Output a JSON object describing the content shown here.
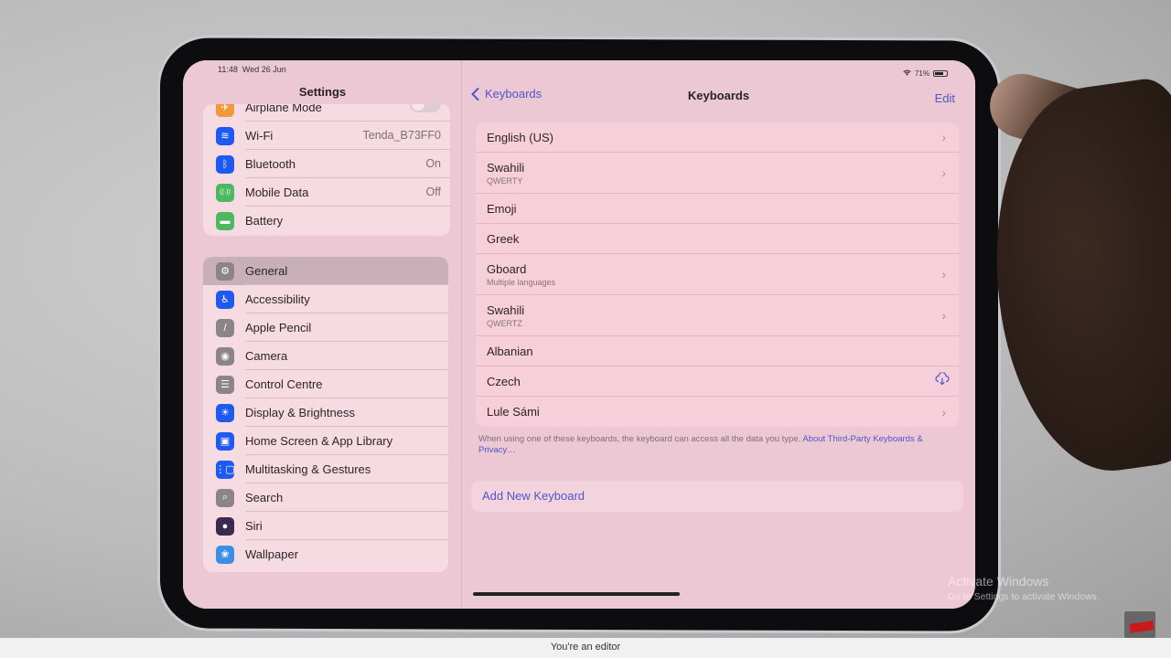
{
  "status": {
    "time": "11:48",
    "date": "Wed 26 Jun",
    "battery": "71%"
  },
  "settings": {
    "title": "Settings",
    "group1": [
      {
        "label": "Airplane Mode",
        "icon": "airplane-icon",
        "color": "#f09a37",
        "toggle": true
      },
      {
        "label": "Wi-Fi",
        "icon": "wifi-icon",
        "color": "#1f5af0",
        "value": "Tenda_B73FF0"
      },
      {
        "label": "Bluetooth",
        "icon": "bluetooth-icon",
        "color": "#1f5af0",
        "value": "On"
      },
      {
        "label": "Mobile Data",
        "icon": "antenna-icon",
        "color": "#4cb860",
        "value": "Off"
      },
      {
        "label": "Battery",
        "icon": "battery-icon",
        "color": "#4cb860"
      }
    ],
    "group2": [
      {
        "label": "General",
        "icon": "gear-icon",
        "color": "#8b8488",
        "selected": true
      },
      {
        "label": "Accessibility",
        "icon": "accessibility-icon",
        "color": "#1f5af0"
      },
      {
        "label": "Apple Pencil",
        "icon": "pencil-icon",
        "color": "#8b8488"
      },
      {
        "label": "Camera",
        "icon": "camera-icon",
        "color": "#8b8488"
      },
      {
        "label": "Control Centre",
        "icon": "switches-icon",
        "color": "#8b8488"
      },
      {
        "label": "Display & Brightness",
        "icon": "sun-icon",
        "color": "#1f5af0"
      },
      {
        "label": "Home Screen & App Library",
        "icon": "home-screen-icon",
        "color": "#1f5af0"
      },
      {
        "label": "Multitasking & Gestures",
        "icon": "multitasking-icon",
        "color": "#1f5af0"
      },
      {
        "label": "Search",
        "icon": "search-icon",
        "color": "#8b8488"
      },
      {
        "label": "Siri",
        "icon": "siri-icon",
        "color": "#3a2b4e"
      },
      {
        "label": "Wallpaper",
        "icon": "flower-icon",
        "color": "#3a8ee6"
      }
    ]
  },
  "keyboards": {
    "back_label": "Keyboards",
    "title": "Keyboards",
    "edit_label": "Edit",
    "items": [
      {
        "name": "English (US)",
        "accessory": "chevron"
      },
      {
        "name": "Swahili",
        "sub": "QWERTY",
        "accessory": "chevron"
      },
      {
        "name": "Emoji"
      },
      {
        "name": "Greek"
      },
      {
        "name": "Gboard",
        "sub": "Multiple languages",
        "accessory": "chevron"
      },
      {
        "name": "Swahili",
        "sub": "QWERTZ",
        "accessory": "chevron"
      },
      {
        "name": "Albanian"
      },
      {
        "name": "Czech",
        "accessory": "cloud"
      },
      {
        "name": "Lule Sámi",
        "accessory": "chevron"
      }
    ],
    "footer_text": "When using one of these keyboards, the keyboard can access all the data you type. ",
    "footer_link": "About Third-Party Keyboards & Privacy…",
    "add_label": "Add New Keyboard"
  },
  "watermark": {
    "line1": "Activate Windows",
    "line2": "Go to Settings to activate Windows."
  },
  "bottom_bar": {
    "text": "You're an editor"
  },
  "colors": {
    "accent": "#4f56c9",
    "screen_tint": "#eecbd6"
  }
}
